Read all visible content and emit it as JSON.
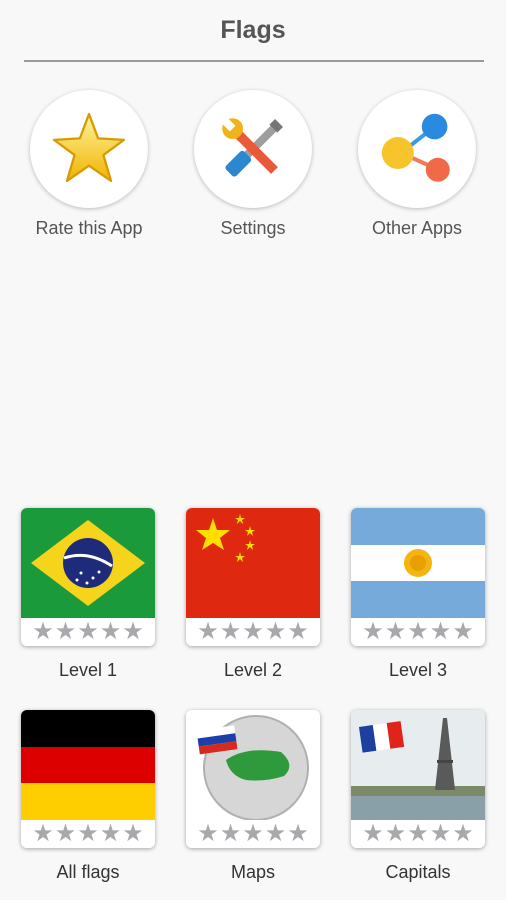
{
  "header": {
    "title": "Flags"
  },
  "top_actions": [
    {
      "label": "Rate this App",
      "icon": "star-icon"
    },
    {
      "label": "Settings",
      "icon": "tools-icon"
    },
    {
      "label": "Other Apps",
      "icon": "share-icon"
    }
  ],
  "levels": [
    {
      "label": "Level 1",
      "image": "brazil-flag",
      "stars_filled": 0,
      "stars_total": 5
    },
    {
      "label": "Level 2",
      "image": "china-flag",
      "stars_filled": 0,
      "stars_total": 5
    },
    {
      "label": "Level 3",
      "image": "argentina-flag",
      "stars_filled": 0,
      "stars_total": 5
    },
    {
      "label": "All flags",
      "image": "germany-flag",
      "stars_filled": 0,
      "stars_total": 5
    },
    {
      "label": "Maps",
      "image": "globe-map",
      "stars_filled": 0,
      "stars_total": 5
    },
    {
      "label": "Capitals",
      "image": "paris-eiffel-tower",
      "stars_filled": 0,
      "stars_total": 5
    }
  ],
  "colors": {
    "star_empty": "#a9a9ad",
    "background": "#f8f8f8",
    "title": "#555555"
  }
}
